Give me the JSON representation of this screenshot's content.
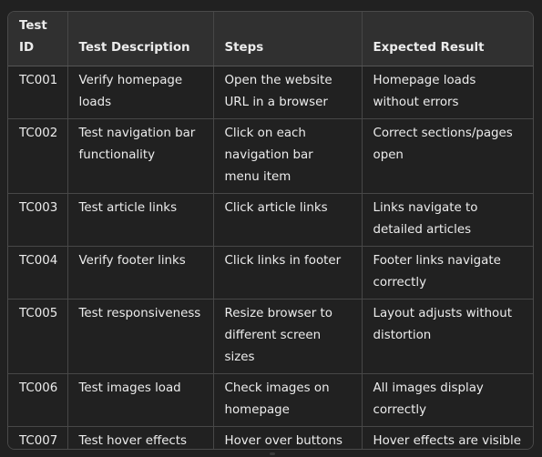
{
  "table": {
    "headers": [
      "Test ID",
      "Test Description",
      "Steps",
      "Expected Result"
    ],
    "header_id_lines": [
      "Test",
      "ID"
    ],
    "rows": [
      [
        "TC001",
        "Verify homepage loads",
        "Open the website URL in a browser",
        "Homepage loads without errors"
      ],
      [
        "TC002",
        "Test navigation bar functionality",
        "Click on each navigation bar menu item",
        "Correct sections/pages open"
      ],
      [
        "TC003",
        "Test article links",
        "Click article links",
        "Links navigate to detailed articles"
      ],
      [
        "TC004",
        "Verify footer links",
        "Click links in footer",
        "Footer links navigate correctly"
      ],
      [
        "TC005",
        "Test responsiveness",
        "Resize browser to different screen sizes",
        "Layout adjusts without distortion"
      ],
      [
        "TC006",
        "Test images load",
        "Check images on homepage",
        "All images display correctly"
      ],
      [
        "TC007",
        "Test hover effects",
        "Hover over buttons and links",
        "Hover effects are visible and functional"
      ]
    ]
  },
  "colors": {
    "background": "#212121",
    "header_background": "#303030",
    "border": "#474747",
    "text": "#ececec"
  }
}
